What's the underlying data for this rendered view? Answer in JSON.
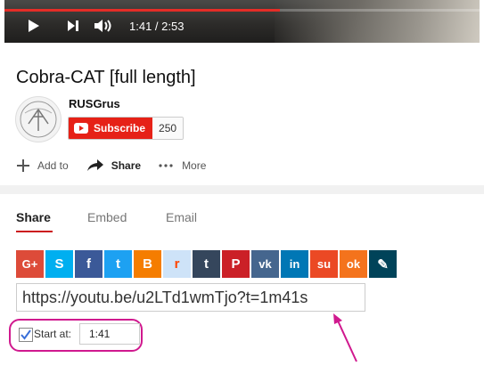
{
  "player": {
    "time": "1:41 / 2:53",
    "progress_fraction": 0.58
  },
  "video": {
    "title": "Cobra-CAT [full length]"
  },
  "channel": {
    "name": "RUSGrus",
    "subscribe_label": "Subscribe",
    "subscriber_count": "250"
  },
  "actions": {
    "add_to": "Add to",
    "share": "Share",
    "more": "More"
  },
  "tabs": [
    {
      "label": "Share"
    },
    {
      "label": "Embed"
    },
    {
      "label": "Email"
    }
  ],
  "social": [
    {
      "name": "google-plus",
      "glyph": "G+",
      "color": "#dd4b39"
    },
    {
      "name": "skype",
      "glyph": "S",
      "color": "#00aff0"
    },
    {
      "name": "facebook",
      "glyph": "f",
      "color": "#3b5998"
    },
    {
      "name": "twitter",
      "glyph": "t",
      "color": "#1da1f2"
    },
    {
      "name": "blogger",
      "glyph": "B",
      "color": "#f57d00"
    },
    {
      "name": "reddit",
      "glyph": "r",
      "color": "#cee3f8"
    },
    {
      "name": "tumblr",
      "glyph": "t",
      "color": "#35465c"
    },
    {
      "name": "pinterest",
      "glyph": "P",
      "color": "#cb2027"
    },
    {
      "name": "vk",
      "glyph": "vk",
      "color": "#45668e"
    },
    {
      "name": "linkedin",
      "glyph": "in",
      "color": "#0077b5"
    },
    {
      "name": "stumbleupon",
      "glyph": "su",
      "color": "#eb4924"
    },
    {
      "name": "odnoklassniki",
      "glyph": "ok",
      "color": "#f4731c"
    },
    {
      "name": "livejournal",
      "glyph": "✎",
      "color": "#004359"
    }
  ],
  "share": {
    "url": "https://youtu.be/u2LTd1wmTjo?t=1m41s",
    "start_label": "Start at:",
    "start_time": "1:41",
    "start_checked": true
  },
  "colors": {
    "annotation": "#d0198e",
    "accent": "#e62117"
  }
}
